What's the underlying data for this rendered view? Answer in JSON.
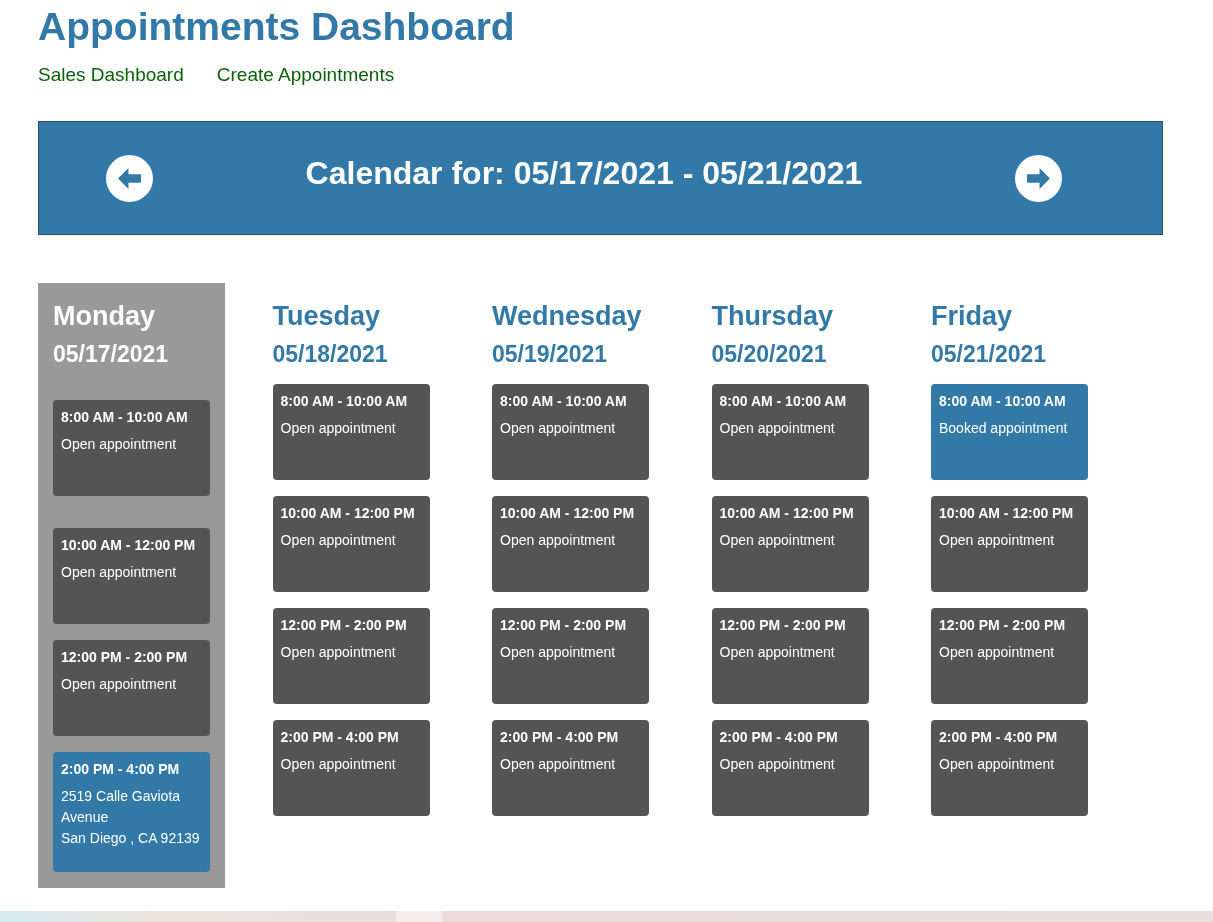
{
  "title": "Appointments Dashboard",
  "nav_links": [
    "Sales Dashboard",
    "Create Appointments"
  ],
  "calendar": {
    "title": "Calendar for: 05/17/2021 - 05/21/2021"
  },
  "days": [
    {
      "name": "Monday",
      "date": "05/17/2021",
      "selected": true,
      "slots": [
        {
          "time": "8:00 AM - 10:00 AM",
          "details": "Open appointment",
          "booked": false
        },
        {
          "time": "10:00 AM - 12:00 PM",
          "details": "Open appointment",
          "booked": false
        },
        {
          "time": "12:00 PM - 2:00 PM",
          "details": "Open appointment",
          "booked": false
        },
        {
          "time": "2:00 PM - 4:00 PM",
          "details": "2519 Calle Gaviota Avenue\nSan Diego , CA 92139",
          "booked": true
        }
      ]
    },
    {
      "name": "Tuesday",
      "date": "05/18/2021",
      "selected": false,
      "slots": [
        {
          "time": "8:00 AM - 10:00 AM",
          "details": "Open appointment",
          "booked": false
        },
        {
          "time": "10:00 AM - 12:00 PM",
          "details": "Open appointment",
          "booked": false
        },
        {
          "time": "12:00 PM - 2:00 PM",
          "details": "Open appointment",
          "booked": false
        },
        {
          "time": "2:00 PM - 4:00 PM",
          "details": "Open appointment",
          "booked": false
        }
      ]
    },
    {
      "name": "Wednesday",
      "date": "05/19/2021",
      "selected": false,
      "slots": [
        {
          "time": "8:00 AM - 10:00 AM",
          "details": "Open appointment",
          "booked": false
        },
        {
          "time": "10:00 AM - 12:00 PM",
          "details": "Open appointment",
          "booked": false
        },
        {
          "time": "12:00 PM - 2:00 PM",
          "details": "Open appointment",
          "booked": false
        },
        {
          "time": "2:00 PM - 4:00 PM",
          "details": "Open appointment",
          "booked": false
        }
      ]
    },
    {
      "name": "Thursday",
      "date": "05/20/2021",
      "selected": false,
      "slots": [
        {
          "time": "8:00 AM - 10:00 AM",
          "details": "Open appointment",
          "booked": false
        },
        {
          "time": "10:00 AM - 12:00 PM",
          "details": "Open appointment",
          "booked": false
        },
        {
          "time": "12:00 PM - 2:00 PM",
          "details": "Open appointment",
          "booked": false
        },
        {
          "time": "2:00 PM - 4:00 PM",
          "details": "Open appointment",
          "booked": false
        }
      ]
    },
    {
      "name": "Friday",
      "date": "05/21/2021",
      "selected": false,
      "slots": [
        {
          "time": "8:00 AM - 10:00 AM",
          "details": "Booked appointment",
          "booked": true
        },
        {
          "time": "10:00 AM - 12:00 PM",
          "details": "Open appointment",
          "booked": false
        },
        {
          "time": "12:00 PM - 2:00 PM",
          "details": "Open appointment",
          "booked": false
        },
        {
          "time": "2:00 PM - 4:00 PM",
          "details": "Open appointment",
          "booked": false
        }
      ]
    }
  ]
}
